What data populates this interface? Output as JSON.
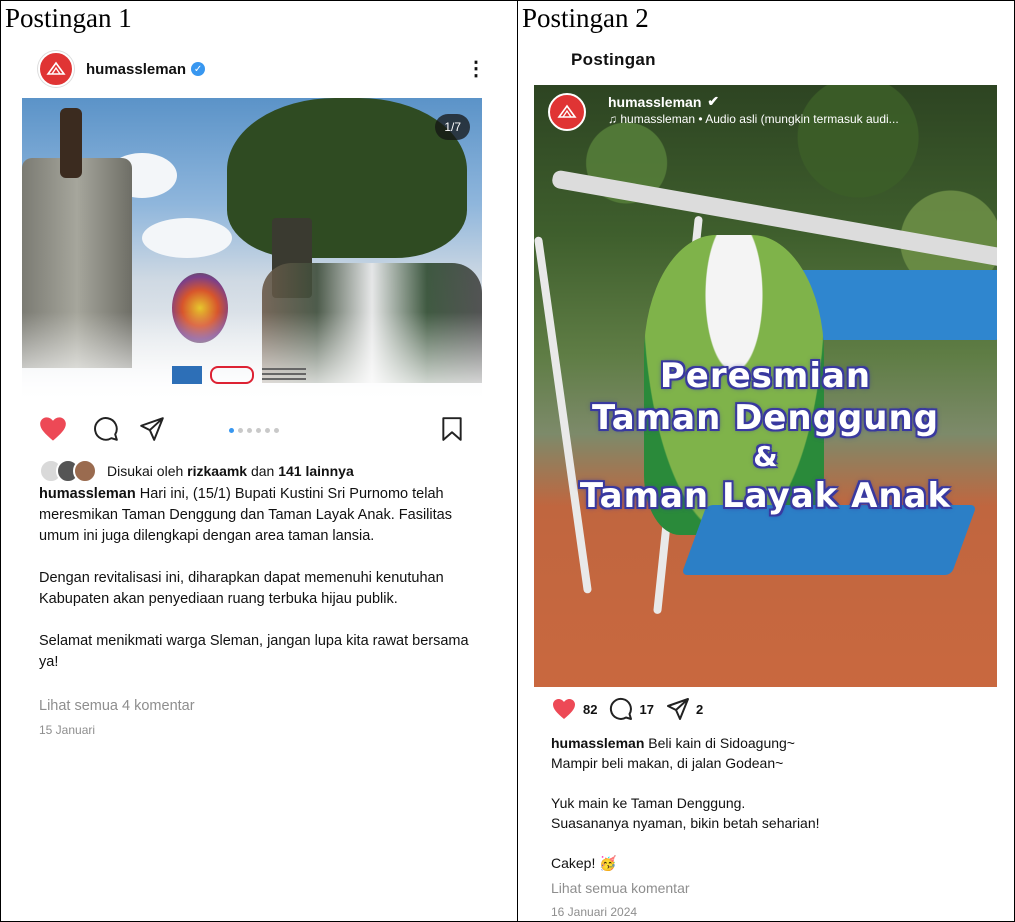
{
  "left": {
    "cell_title": "Postingan 1",
    "username": "humassleman",
    "image_counter": "1/7",
    "liked_by_prefix": "Disukai oleh",
    "liked_by_user": "rizkaamk",
    "liked_by_connector": "dan",
    "liked_by_others": "141 lainnya",
    "caption_user": "humassleman",
    "caption_p1": "Hari ini, (15/1) Bupati Kustini Sri Purnomo telah meresmikan Taman Denggung dan Taman Layak Anak. Fasilitas umum ini juga dilengkapi dengan area taman lansia.",
    "caption_p2": "Dengan revitalisasi ini, diharapkan dapat memenuhi kenutuhan Kabupaten akan penyediaan ruang terbuka hijau publik.",
    "caption_p3": "Selamat menikmati warga Sleman, jangan lupa kita rawat bersama ya!",
    "view_comments": "Lihat semua 4 komentar",
    "date": "15 Januari",
    "carousel_dots": 6,
    "carousel_active": 0
  },
  "right": {
    "cell_title": "Postingan 2",
    "section_label": "Postingan",
    "username": "humassleman",
    "audio": "humassleman • Audio asli (mungkin termasuk audi...",
    "overlay_line1": "Peresmian",
    "overlay_line2": "Taman Denggung",
    "overlay_line3": "&",
    "overlay_line4": "Taman Layak Anak",
    "likes": "82",
    "comments": "17",
    "shares": "2",
    "caption_user": "humassleman",
    "caption_l1": "Beli kain di Sidoagung~",
    "caption_l2": "Mampir beli makan, di jalan Godean~",
    "caption_l3": "Yuk main ke Taman Denggung.",
    "caption_l4": "Suasananya nyaman, bikin betah seharian!",
    "caption_l5": "Cakep! 🥳",
    "view_comments": "Lihat semua komentar",
    "date": "16 Januari 2024"
  },
  "colors": {
    "heart": "#ed4956",
    "verified": "#3897f0",
    "muted": "#8e8e8e",
    "avatar_red": "#e03434"
  }
}
